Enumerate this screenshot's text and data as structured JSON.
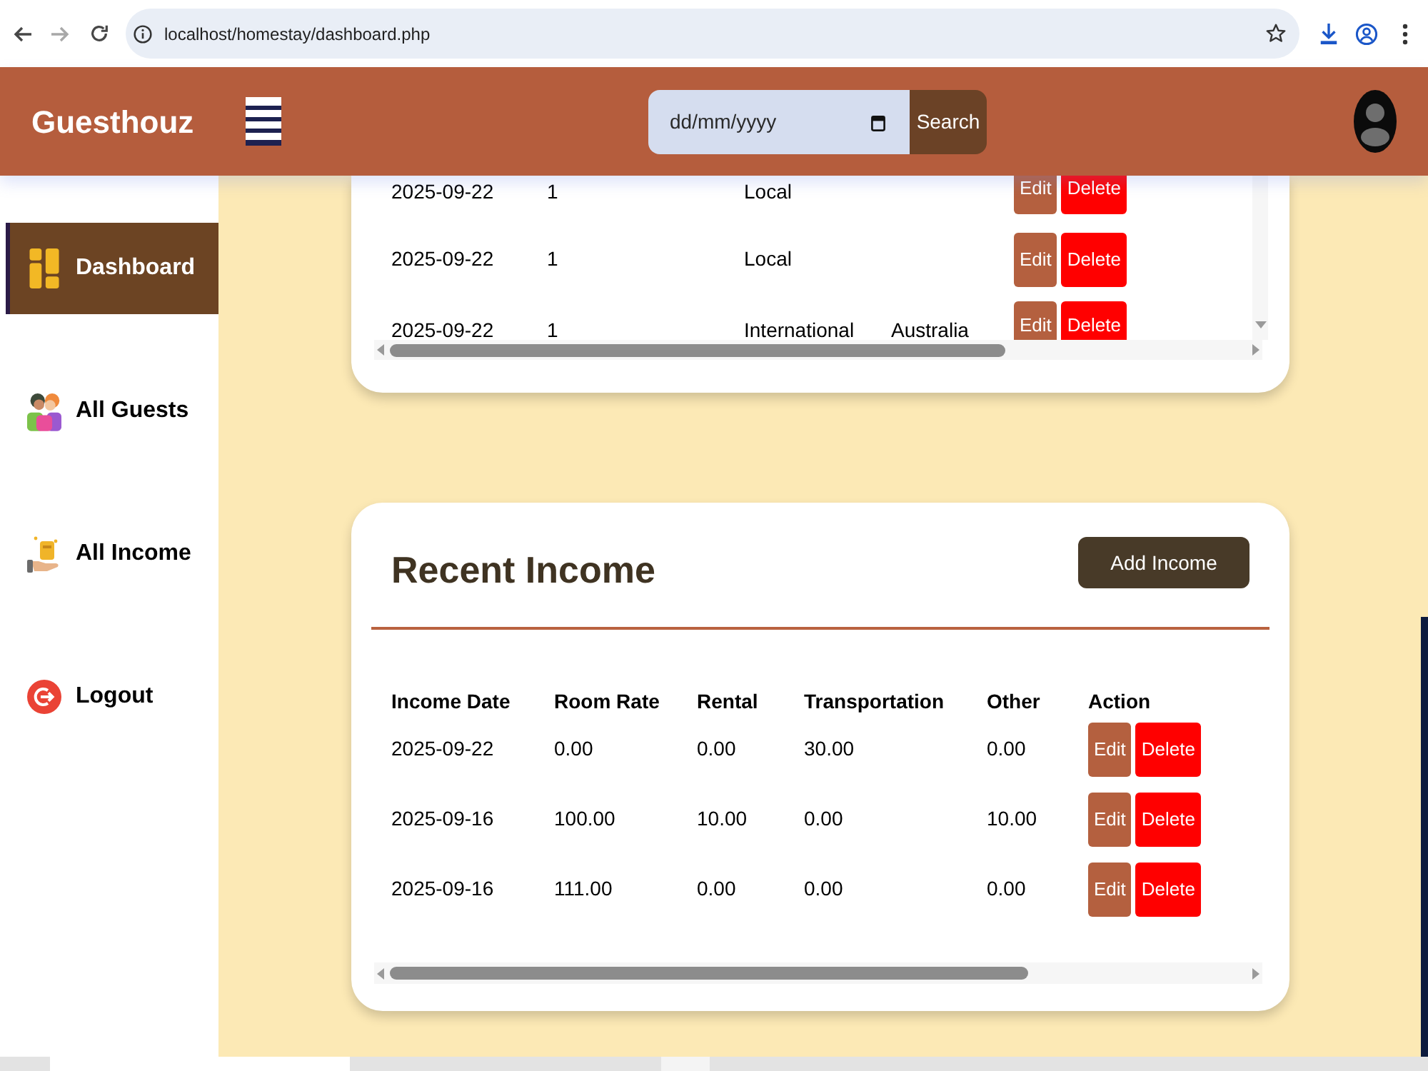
{
  "browser": {
    "url": "localhost/homestay/dashboard.php",
    "forward_disabled": true
  },
  "header": {
    "brand": "Guesthouz",
    "date_field": {
      "placeholder": "dd/mm/yyyy"
    },
    "search_button": "Search"
  },
  "sidebar": {
    "items": [
      {
        "label": "Dashboard",
        "selected": true
      },
      {
        "label": "All Guests",
        "selected": false
      },
      {
        "label": "All Income",
        "selected": false
      },
      {
        "label": "Logout",
        "selected": false
      }
    ]
  },
  "guest_table": {
    "rows": [
      {
        "column_1": "2025-09-22",
        "column_2": "1",
        "column_3": "Local",
        "actions": [
          {
            "kind": "edit",
            "label": "Edit"
          },
          {
            "kind": "delete",
            "label": "Delete"
          }
        ]
      },
      {
        "column_1": "2025-09-22",
        "column_2": "1",
        "column_3": "Local",
        "actions": [
          {
            "kind": "edit",
            "label": "Edit"
          },
          {
            "kind": "delete",
            "label": "Delete"
          }
        ]
      },
      {
        "column_1": "2025-09-22",
        "column_2": "1",
        "column_3": "International",
        "column_4": "Australia",
        "actions": [
          {
            "kind": "edit",
            "label": "Edit"
          },
          {
            "kind": "delete",
            "label": "Delete"
          }
        ]
      }
    ]
  },
  "recent_income": {
    "title": "Recent Income",
    "add_button": "Add Income",
    "columns": [
      "Income Date",
      "Room Rate",
      "Rental",
      "Transportation",
      "Other",
      "Action"
    ],
    "rows": [
      {
        "cells": [
          "2025-09-22",
          "0.00",
          "0.00",
          "30.00",
          "0.00"
        ],
        "actions": [
          {
            "kind": "edit",
            "label": "Edit"
          },
          {
            "kind": "delete",
            "label": "Delete"
          }
        ]
      },
      {
        "cells": [
          "2025-09-16",
          "100.00",
          "10.00",
          "0.00",
          "10.00"
        ],
        "actions": [
          {
            "kind": "edit",
            "label": "Edit"
          },
          {
            "kind": "delete",
            "label": "Delete"
          }
        ]
      },
      {
        "cells": [
          "2025-09-16",
          "111.00",
          "0.00",
          "0.00",
          "0.00"
        ],
        "actions": [
          {
            "kind": "edit",
            "label": "Edit"
          },
          {
            "kind": "delete",
            "label": "Delete"
          }
        ]
      }
    ]
  }
}
